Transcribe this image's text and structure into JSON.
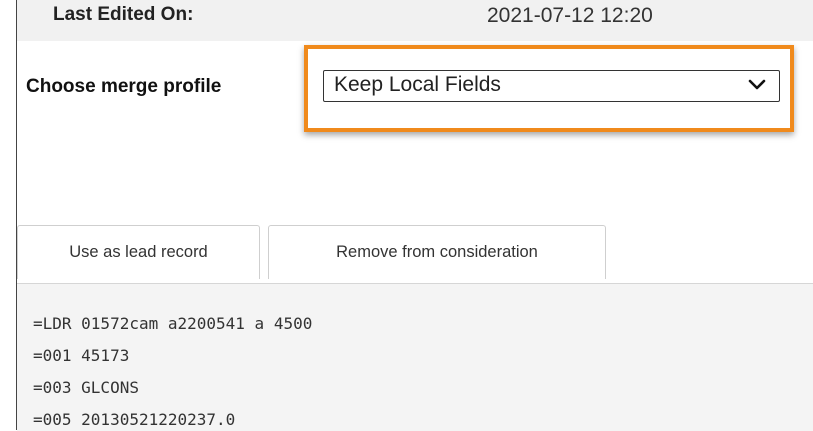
{
  "record_info": {
    "last_edited_label": "Last Edited On:",
    "last_edited_value": "2021-07-12 12:20"
  },
  "merge": {
    "label": "Choose merge profile",
    "selected_profile": "Keep Local Fields",
    "highlight_color": "#f08a1c"
  },
  "actions": {
    "lead_label": "Use as lead record",
    "remove_label": "Remove from consideration"
  },
  "marc_lines": [
    "=LDR 01572cam a2200541 a 4500",
    "=001 45173",
    "=003 GLCONS",
    "=005 20130521220237.0"
  ],
  "icons": {
    "select_icon": "chevron-down-icon"
  }
}
